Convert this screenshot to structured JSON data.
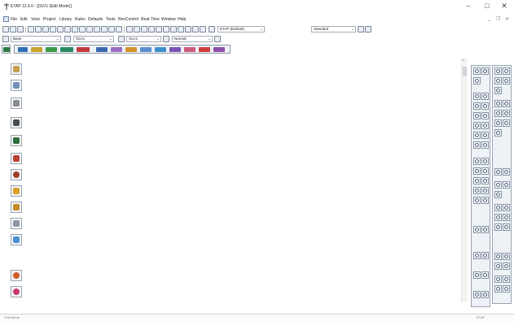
{
  "window": {
    "title": "ETAP 12.6.0 - [OLV1 (Edit Mode)]",
    "minimize_glyph": "–",
    "maximize_glyph": "□",
    "close_glyph": "✕"
  },
  "menubar": {
    "items": [
      "File",
      "Edit",
      "View",
      "Project",
      "Library",
      "Rules",
      "Defaults",
      "Tools",
      "RevControl",
      "Real-Time",
      "Window",
      "Help"
    ],
    "mdi_controls": [
      "_",
      "❐",
      "✕"
    ]
  },
  "toolbar1": {
    "revision_combo": "ETAP (Default)",
    "study_combo": "Standard"
  },
  "toolbar2": {
    "base_combo": "Base",
    "presentation_combo": "OLV1",
    "config_combo": "OLV1",
    "mode_combo": "Normal"
  },
  "status": {
    "left": "Edit Mode",
    "right": "ETAP"
  },
  "colors": {
    "accent": "#3b6fb6",
    "toolbar_bg": "#e7edf5",
    "icon_border": "#7a8696"
  },
  "icons": {
    "left_toolbar": [
      "edit-mode-icon",
      "one-line-icon",
      "underground-raceway-icon",
      "ground-grid-icon",
      "cable-icon",
      "pen-icon",
      "globe-icon",
      "dashboard-icon",
      "panel-system-icon",
      "control-circuit-icon",
      "user-defined-icon",
      "network-icon",
      "bus-icon"
    ]
  }
}
